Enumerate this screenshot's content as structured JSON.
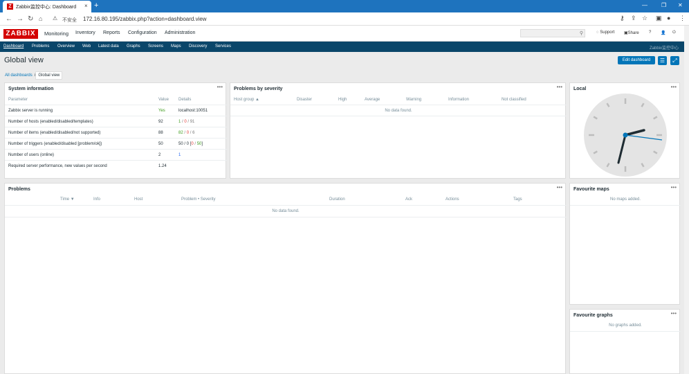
{
  "browser": {
    "tab_title": "Zabbix监控中心: Dashboard",
    "tab_icon": "Z",
    "new_tab": "+",
    "insecure": "不安全",
    "url": "172.16.80.195/zabbix.php?action=dashboard.view"
  },
  "header": {
    "logo": "ZABBIX",
    "menu": [
      "Monitoring",
      "Inventory",
      "Reports",
      "Configuration",
      "Administration"
    ],
    "support": "Support",
    "share": "Share",
    "help": "?"
  },
  "subnav": {
    "items": [
      "Dashboard",
      "Problems",
      "Overview",
      "Web",
      "Latest data",
      "Graphs",
      "Screens",
      "Maps",
      "Discovery",
      "Services"
    ],
    "server_name": "Zabbix监控中心"
  },
  "page": {
    "title": "Global view",
    "edit_button": "Edit dashboard",
    "breadcrumb": [
      "All dashboards",
      "Global view"
    ]
  },
  "system_info": {
    "title": "System information",
    "columns": [
      "Parameter",
      "Value",
      "Details"
    ],
    "rows": [
      {
        "param": "Zabbix server is running",
        "value": "Yes",
        "details": [
          "localhost:10051"
        ]
      },
      {
        "param": "Number of hosts (enabled/disabled/templates)",
        "value": "92",
        "details": [
          "1",
          " / ",
          "0",
          " / ",
          "91"
        ]
      },
      {
        "param": "Number of items (enabled/disabled/not supported)",
        "value": "88",
        "details": [
          "82",
          " / ",
          "0",
          " / ",
          "6"
        ]
      },
      {
        "param": "Number of triggers (enabled/disabled [problem/ok])",
        "value": "50",
        "details": [
          "50 / 0 [",
          "0",
          " / ",
          "50",
          "]"
        ]
      },
      {
        "param": "Number of users (online)",
        "value": "2",
        "details": [
          "1"
        ]
      },
      {
        "param": "Required server performance, new values per second",
        "value": "1.24",
        "details": [
          ""
        ]
      }
    ]
  },
  "severity": {
    "title": "Problems by severity",
    "columns": [
      "Host group ▲",
      "Disaster",
      "High",
      "Average",
      "Warning",
      "Information",
      "Not classified"
    ],
    "empty": "No data found."
  },
  "clock": {
    "title": "Local"
  },
  "problems": {
    "title": "Problems",
    "columns": [
      "Time ▼",
      "Info",
      "Host",
      "Problem • Severity",
      "Duration",
      "Ack",
      "Actions",
      "Tags"
    ],
    "empty": "No data found."
  },
  "fav_maps": {
    "title": "Favourite maps",
    "empty": "No maps added."
  },
  "fav_graphs": {
    "title": "Favourite graphs",
    "empty": "No graphs added."
  },
  "colors": {
    "tabbar": "#1e73be",
    "subnav": "#0a466a",
    "accent": "#0275b8",
    "logo": "#d40000"
  }
}
